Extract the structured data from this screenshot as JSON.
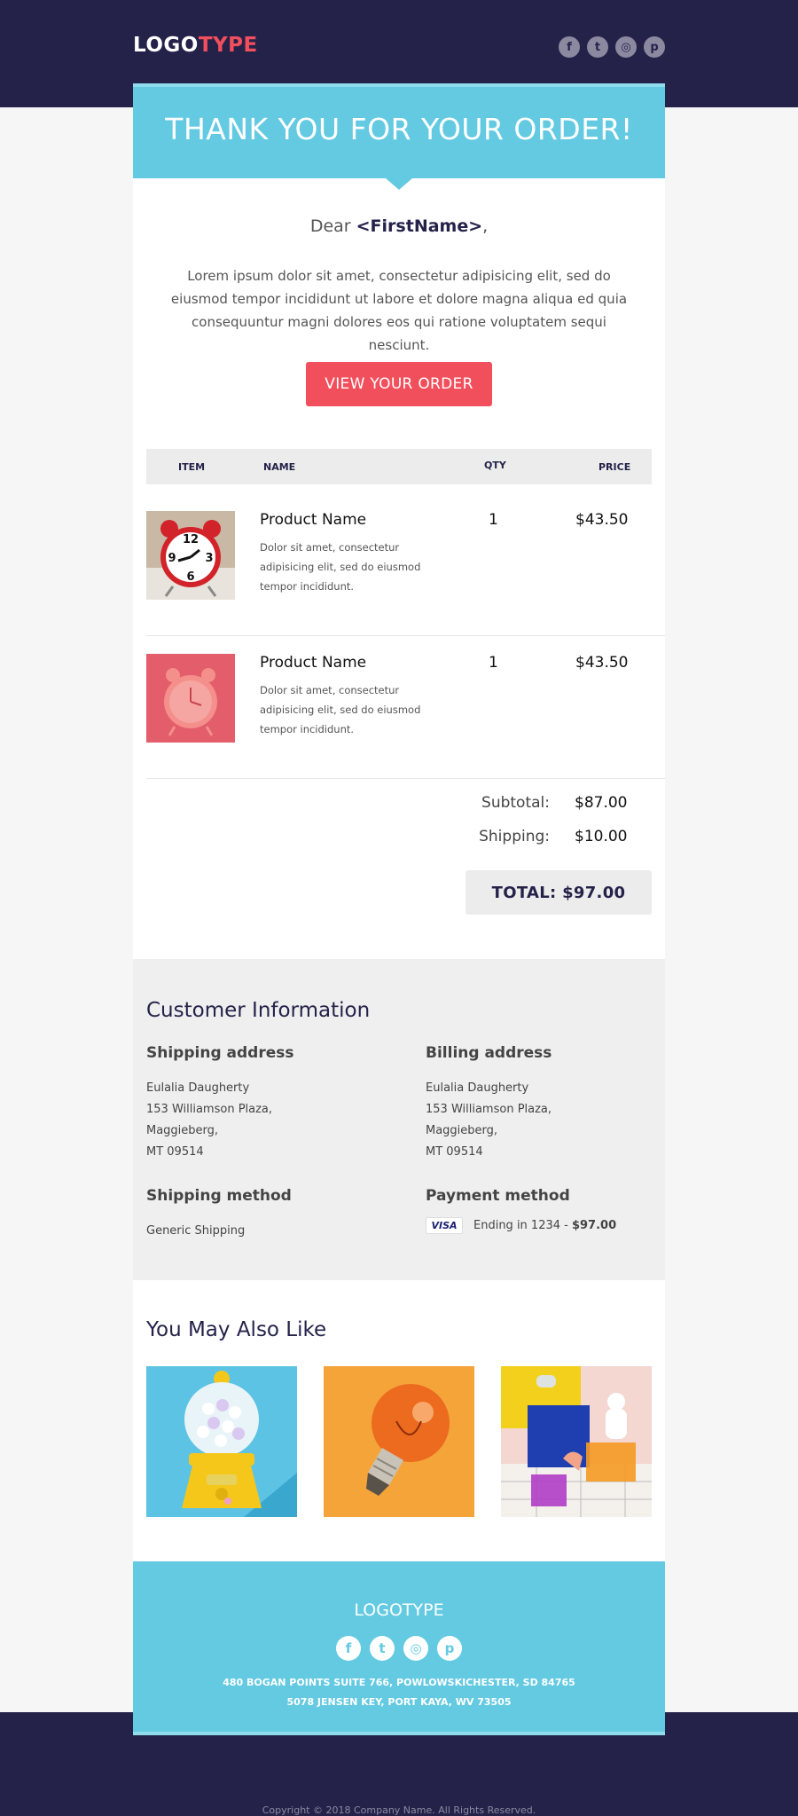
{
  "header": {
    "logo_part1": "LOGO",
    "logo_part2": "TYPE",
    "social_icons": [
      "facebook-icon",
      "twitter-icon",
      "instagram-icon",
      "pinterest-icon"
    ]
  },
  "hero": {
    "title": "THANK YOU FOR YOUR ORDER!"
  },
  "greeting": {
    "prefix": "Dear ",
    "name": "<FirstName>",
    "suffix": ","
  },
  "intro": "Lorem ipsum dolor sit amet, consectetur adipisicing elit, sed do eiusmod tempor incididunt ut labore et dolore magna aliqua ed quia consequuntur magni dolores eos qui ratione voluptatem sequi nesciunt.",
  "cta_label": "VIEW YOUR ORDER",
  "table": {
    "headers": {
      "item": "ITEM",
      "name": "NAME",
      "qty": "QTY",
      "price": "PRICE"
    },
    "rows": [
      {
        "name": "Product Name",
        "desc": "Dolor sit amet, consectetur adipisicing elit, sed do eiusmod tempor incididunt.",
        "qty": "1",
        "price": "$43.50"
      },
      {
        "name": "Product Name",
        "desc": "Dolor sit amet, consectetur adipisicing elit, sed do eiusmod tempor incididunt.",
        "qty": "1",
        "price": "$43.50"
      }
    ]
  },
  "totals": {
    "subtotal_label": "Subtotal:",
    "subtotal": "$87.00",
    "shipping_label": "Shipping:",
    "shipping": "$10.00",
    "total": "TOTAL: $97.00"
  },
  "customer": {
    "title": "Customer Information",
    "shipping_title": "Shipping address",
    "billing_title": "Billing address",
    "shipping_address": [
      "Eulalia Daugherty",
      "153 Williamson Plaza,",
      "Maggieberg,",
      "MT 09514"
    ],
    "billing_address": [
      "Eulalia Daugherty",
      "153 Williamson Plaza,",
      "Maggieberg,",
      "MT 09514"
    ],
    "method_title": "Shipping method",
    "method": "Generic Shipping",
    "payment_title": "Payment method",
    "card_brand": "VISA",
    "payment_text": "Ending in 1234 - ",
    "payment_amount": "$97.00"
  },
  "recommend": {
    "title": "You May Also Like"
  },
  "footer": {
    "logo": "LOGOTYPE",
    "address1": "480 BOGAN POINTS SUITE 766, POWLOWSKICHESTER, SD 84765",
    "address2": "5078 JENSEN KEY, PORT KAYA, WV 73505"
  },
  "copyright": "Copyright © 2018 Company Name. All Rights Reserved.",
  "colors": {
    "navy": "#25224a",
    "accent": "#f24f5c",
    "sky": "#63cae2"
  }
}
